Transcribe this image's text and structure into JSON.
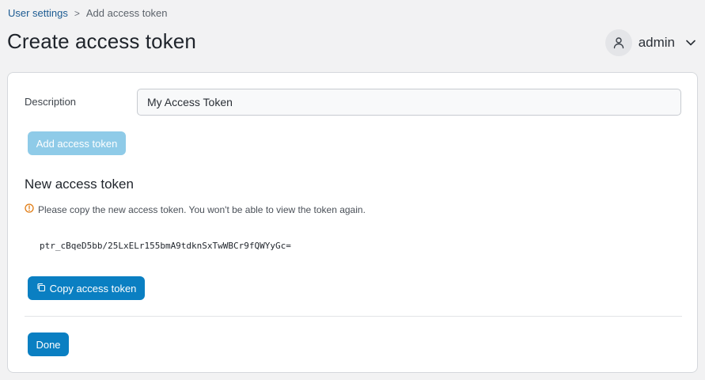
{
  "breadcrumb": {
    "parent": "User settings",
    "separator": ">",
    "current": "Add access token"
  },
  "header": {
    "title": "Create access token",
    "user": "admin"
  },
  "form": {
    "description_label": "Description",
    "description_value": "My Access Token",
    "add_button": "Add access token"
  },
  "new_token": {
    "heading": "New access token",
    "warning": "Please copy the new access token. You won't be able to view the token again.",
    "value": "ptr_cBqeD5bb/25LxELr155bmA9tdknSxTwWBCr9fQWYyGc=",
    "copy_button": "Copy access token"
  },
  "footer": {
    "done_button": "Done"
  },
  "colors": {
    "primary": "#0a7fc2",
    "primary_disabled": "#8fcbe8",
    "warning": "#e07b12",
    "link": "#1c5b92"
  }
}
